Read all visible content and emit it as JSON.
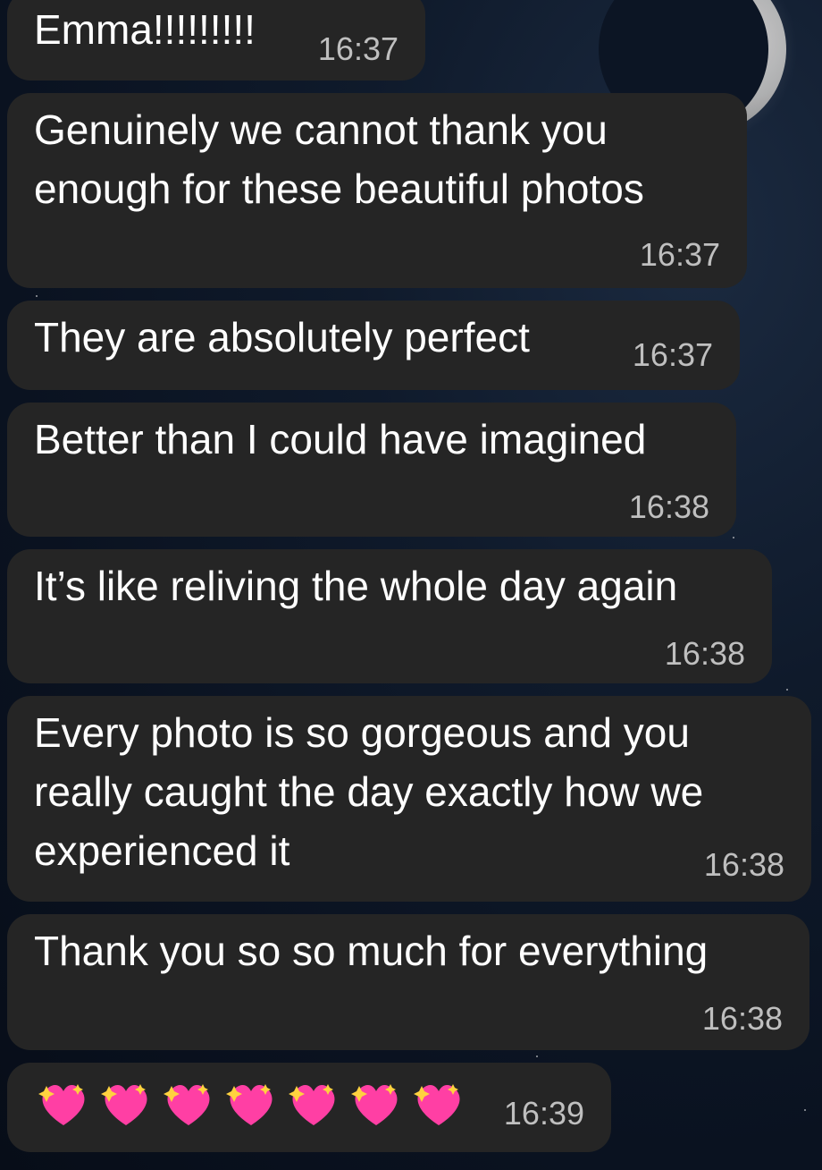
{
  "messages": [
    {
      "id": 1,
      "text": "Emma!!!!!!!!!",
      "time": "16:37"
    },
    {
      "id": 2,
      "text": "Genuinely we cannot thank you\nenough for these beautiful photos",
      "time": "16:37"
    },
    {
      "id": 3,
      "text": "They are absolutely perfect",
      "time": "16:37"
    },
    {
      "id": 4,
      "text": "Better than I could have imagined",
      "time": "16:38"
    },
    {
      "id": 5,
      "text": "It’s like reliving the whole day again",
      "time": "16:38"
    },
    {
      "id": 6,
      "text": "Every photo is so gorgeous and you\nreally caught the day exactly how we\nexperienced it",
      "time": "16:38"
    },
    {
      "id": 7,
      "text": "Thank you so so much for everything",
      "time": "16:38"
    },
    {
      "id": 8,
      "emoji": "sparkling-heart",
      "emoji_count": 7,
      "time": "16:39"
    }
  ],
  "colors": {
    "bubble": "#252525",
    "text": "#ffffff",
    "time": "#bfbfbf",
    "heart": "#ff3fa4",
    "sparkle": "#ffd23f"
  }
}
